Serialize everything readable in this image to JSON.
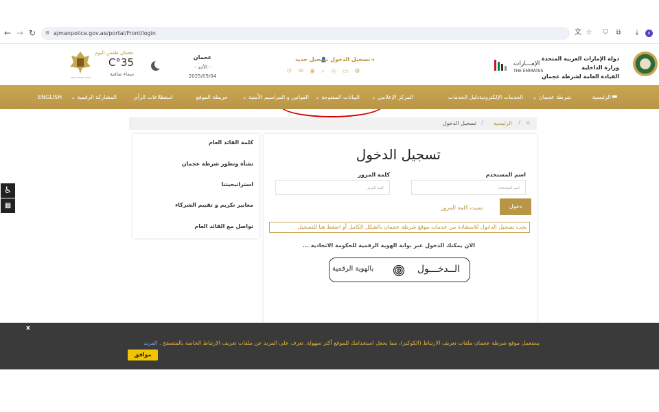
{
  "browser": {
    "url": "ajmanpolice.gov.ae/portal/Front/login",
    "icons": [
      "back-arrow-icon",
      "forward-arrow-icon",
      "reload-icon",
      "site-info-icon",
      "translate-icon",
      "star-icon",
      "shield-icon",
      "extensions-icon",
      "download-icon",
      "profile-icon"
    ]
  },
  "header": {
    "org_line1": "دولة الإمارات العربية المتحدة",
    "org_line2": "وزارة الداخلية",
    "org_line3": "القيادة العامة لشرطة عجمان",
    "emirates_ar": "الإمـــارات",
    "emirates_en": "THE EMIRATES",
    "login_link": "تسجيل الدخول",
    "register_link": "تسجيل جديد",
    "city": "عجمان",
    "day": "- الأحد -",
    "date": "2025/05/04",
    "weather_label": "عجمان طقس اليوم",
    "temperature": "C°35",
    "sky": "سماء صافية",
    "seal_caption": "Ajman Royal Diwan"
  },
  "menu": {
    "items": [
      {
        "label": "الرئيسية",
        "dropdown": false
      },
      {
        "label": "شرطة عجمان",
        "dropdown": true
      },
      {
        "label": "الخدمات الإلكترونية",
        "dropdown": true
      },
      {
        "label": "دليل الخدمات",
        "dropdown": false
      },
      {
        "label": "المركز الإعلامي",
        "dropdown": true
      },
      {
        "label": "البيانات المفتوحة",
        "dropdown": true
      },
      {
        "label": "القوانين و المراسيم الأمنية",
        "dropdown": true
      },
      {
        "label": "خريطة الموقع",
        "dropdown": false
      },
      {
        "label": "استطلاعات الرأي",
        "dropdown": false
      },
      {
        "label": "المشاركة الرقمية",
        "dropdown": true
      },
      {
        "label": "ENGLISH",
        "dropdown": false
      }
    ]
  },
  "breadcrumb": {
    "home": "الرئيسية",
    "current": "تسجيل الدخول"
  },
  "login": {
    "title": "تسجيل الدخول",
    "username_label": "اسم المستخدم",
    "username_placeholder": "اسم المستخدم",
    "password_label": "كلمة المرور",
    "password_placeholder": "كلمة المرور",
    "submit": "دخول",
    "forgot": "نسيت كلمة المرور",
    "notice": "يجب تسجيل الدخول للاستفادة من خدمات موقع شرطة عجمان بالشكل الكامل أو",
    "register_here": "اضغط هنا للتسجيل",
    "uaepass_note": "الان يمكنك الدخول عبر بوابة الهوية الرقمية للحكومة الاتحادية ...",
    "uaepass_btn_main": "الــدخـــول",
    "uaepass_btn_sub": "بالهوية الرقمية"
  },
  "side_menu": {
    "items": [
      "كلمة القائد العام",
      "نشأة وتطور شرطة عجمان",
      "استراتيجيتنا",
      "معايير تكريم و تقييم الشركاء",
      "تواصل مع القائد العام"
    ]
  },
  "cookie": {
    "close": "x",
    "text": "يستعمل موقع شرطة عجمان ملفات تعريف الارتباط (الكوكيز)، مما يجعل استخدامك للموقع أكثر سهولة. تعرف على المزيد عن ملفات تعريف الارتباط الخاصة بالمتصفح .",
    "more": "المزيد",
    "accept": "موافق"
  },
  "colors": {
    "gold": "#b8923e",
    "menu_bg": "#c2a04e",
    "highlight_oval": "#d40000",
    "cookie_bg": "#3a3a3a",
    "cookie_text": "#e3b43a",
    "accept_btn": "#f2c500"
  }
}
